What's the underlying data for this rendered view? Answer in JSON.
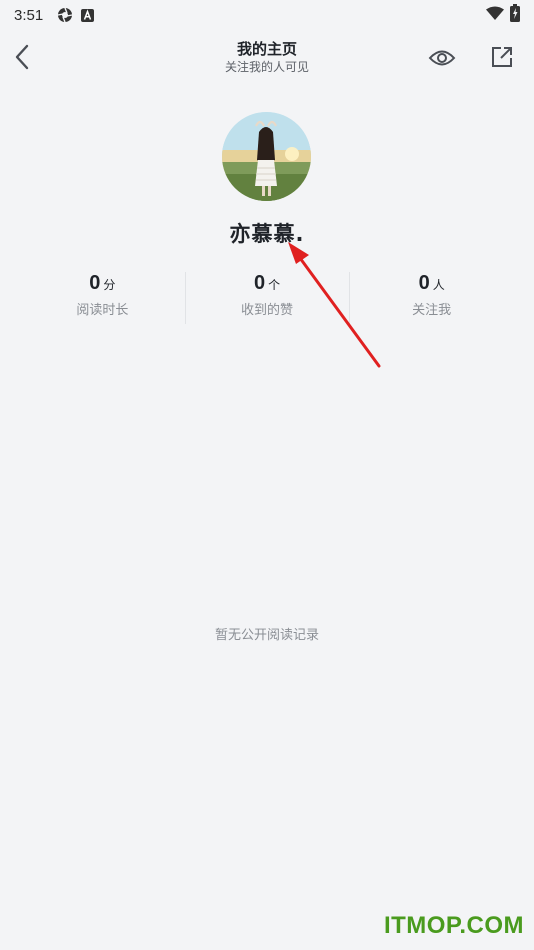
{
  "status_bar": {
    "time": "3:51",
    "icons": [
      "shutter-icon",
      "a-badge-icon",
      "wifi-icon",
      "battery-charging-icon"
    ]
  },
  "header": {
    "title": "我的主页",
    "subtitle": "关注我的人可见",
    "icons": [
      "back-chevron-icon",
      "eye-icon",
      "share-external-icon"
    ]
  },
  "profile": {
    "username": "亦慕慕."
  },
  "stats": [
    {
      "value": "0",
      "unit": "分",
      "label": "阅读时长"
    },
    {
      "value": "0",
      "unit": "个",
      "label": "收到的赞"
    },
    {
      "value": "0",
      "unit": "人",
      "label": "关注我"
    }
  ],
  "empty_state": "暂无公开阅读记录",
  "annotation": {
    "arrow_color": "#e02020"
  },
  "watermark": "ITMOP.COM",
  "colors": {
    "background": "#f3f4f6",
    "text_primary": "#1f2329",
    "text_secondary": "#8a8e94",
    "watermark": "#4a9b1e"
  }
}
